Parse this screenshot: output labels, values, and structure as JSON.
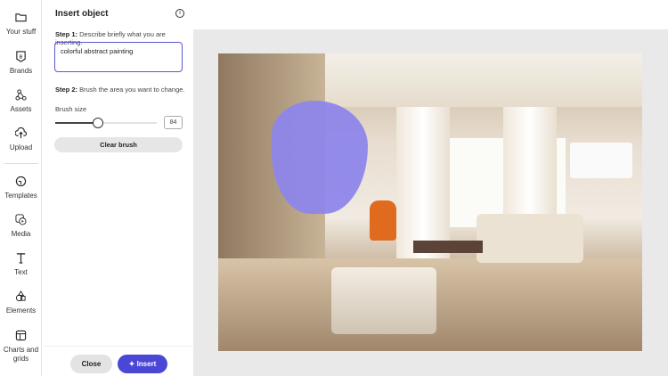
{
  "rail": [
    {
      "label": "Your stuff",
      "icon": "folder-icon"
    },
    {
      "label": "Brands",
      "icon": "brand-icon"
    },
    {
      "label": "Assets",
      "icon": "assets-icon"
    },
    {
      "label": "Upload",
      "icon": "upload-icon"
    },
    {
      "label": "Templates",
      "icon": "templates-icon"
    },
    {
      "label": "Media",
      "icon": "media-icon"
    },
    {
      "label": "Text",
      "icon": "text-icon"
    },
    {
      "label": "Elements",
      "icon": "elements-icon"
    },
    {
      "label": "Charts and grids",
      "icon": "charts-icon"
    }
  ],
  "panel": {
    "title": "Insert object",
    "step1_label": "Step 1:",
    "step1_text": "Describe briefly what you are inserting.",
    "prompt_value": "colorful abstract painting",
    "step2_label": "Step 2:",
    "step2_text": "Brush the area you want to change.",
    "brush_size_label": "Brush size",
    "brush_size": "84",
    "brush_fraction": 0.42,
    "clear_label": "Clear brush",
    "close_label": "Close",
    "insert_label": "Insert"
  },
  "colors": {
    "accent": "#4b47d6",
    "mask": "#8e86ea"
  }
}
